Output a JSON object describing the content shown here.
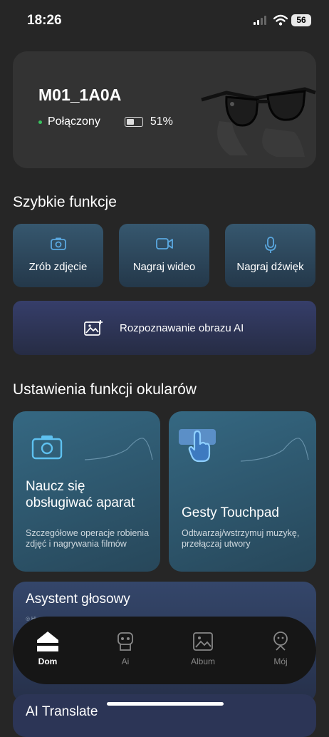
{
  "status": {
    "time": "18:26",
    "battery": "56"
  },
  "device": {
    "name": "M01_1A0A",
    "connection": "Połączony",
    "battery": "51%",
    "battery_level": 0.51,
    "image": "smart-glasses"
  },
  "quick": {
    "heading": "Szybkie funkcje",
    "items": [
      {
        "label": "Zrób zdjęcie",
        "icon": "camera-icon"
      },
      {
        "label": "Nagraj wideo",
        "icon": "video-icon"
      },
      {
        "label": "Nagraj dźwięk",
        "icon": "microphone-icon"
      }
    ],
    "ai": {
      "label": "Rozpoznawanie obrazu AI",
      "icon": "image-sparkle-icon"
    }
  },
  "settings": {
    "heading": "Ustawienia funkcji okularów",
    "camera": {
      "title_line1": "Naucz się",
      "title_line2": "obsługiwać aparat",
      "desc": "Szczegółowe operacje robienia zdjęć i nagrywania filmów"
    },
    "touchpad": {
      "title": "Gesty Touchpad",
      "desc": "Odtwarzaj/wstrzymuj muzykę, przełączaj utwory"
    }
  },
  "voice": {
    "title": "Asystent głosowy",
    "tiny": "◎ Hi"
  },
  "translate": {
    "title": "AI Translate"
  },
  "tabs": [
    {
      "label": "Dom",
      "icon": "home-icon",
      "active": true
    },
    {
      "label": "Ai",
      "icon": "robot-icon",
      "active": false
    },
    {
      "label": "Album",
      "icon": "album-icon",
      "active": false
    },
    {
      "label": "Mój",
      "icon": "profile-icon",
      "active": false
    }
  ],
  "colors": {
    "accent_green": "#39c35f",
    "card_blue": "#356882",
    "background": "#262626"
  }
}
